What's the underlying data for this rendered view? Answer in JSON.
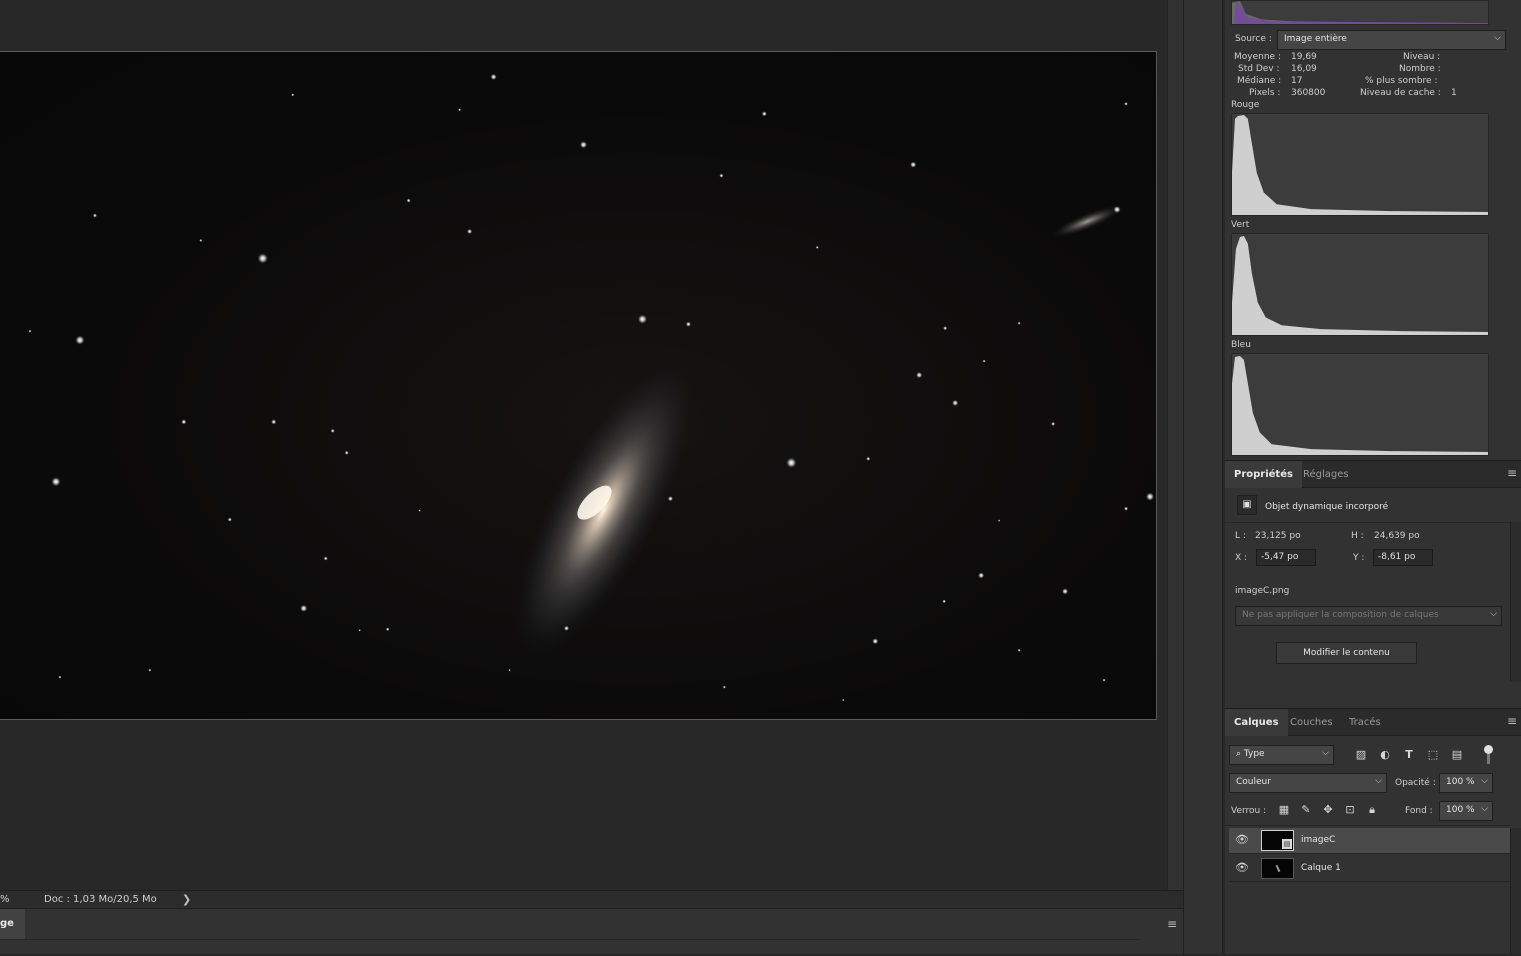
{
  "status_bar": {
    "zoom": "%",
    "doc_info": "Doc : 1,03 Mo/20,5 Mo",
    "arrow": "❯"
  },
  "bottom_panel": {
    "tab_label": "ge",
    "menu_icon": "hamburger-icon"
  },
  "histogram": {
    "source_label": "Source :",
    "source_value": "Image entière",
    "stats": {
      "moyenne_label": "Moyenne :",
      "moyenne": "19,69",
      "stddev_label": "Std Dev :",
      "stddev": "16,09",
      "mediane_label": "Médiane :",
      "mediane": "17",
      "pixels_label": "Pixels :",
      "pixels": "360800",
      "niveau_label": "Niveau :",
      "niveau": "",
      "nombre_label": "Nombre :",
      "nombre": "",
      "sombre_label": "% plus sombre :",
      "sombre": "",
      "cache_label": "Niveau de cache :",
      "cache": "1"
    },
    "channels": [
      "Rouge",
      "Vert",
      "Bleu"
    ]
  },
  "properties": {
    "tabs": [
      "Propriétés",
      "Réglages"
    ],
    "object_type": "Objet dynamique incorporé",
    "w_label": "L :",
    "w_value": "23,125 po",
    "h_label": "H :",
    "h_value": "24,639 po",
    "x_label": "X :",
    "x_value": "-5,47 po",
    "y_label": "Y :",
    "y_value": "-8,61 po",
    "filename": "imageC.png",
    "comp_placeholder": "Ne pas appliquer la composition de calques",
    "edit_button": "Modifier le contenu"
  },
  "layers": {
    "tabs": [
      "Calques",
      "Couches",
      "Tracés"
    ],
    "filter_label": "Type",
    "blend_mode": "Couleur",
    "opacity_label": "Opacité :",
    "opacity_value": "100 %",
    "lock_label": "Verrou :",
    "fill_label": "Fond :",
    "fill_value": "100 %",
    "items": [
      {
        "name": "imageC",
        "selected": true
      },
      {
        "name": "Calque 1",
        "selected": false
      }
    ]
  },
  "colors": {
    "background": "#282828",
    "panel": "#323232",
    "selected_layer": "#4a4a4a",
    "histogram_fill": "#cfcfcf"
  }
}
